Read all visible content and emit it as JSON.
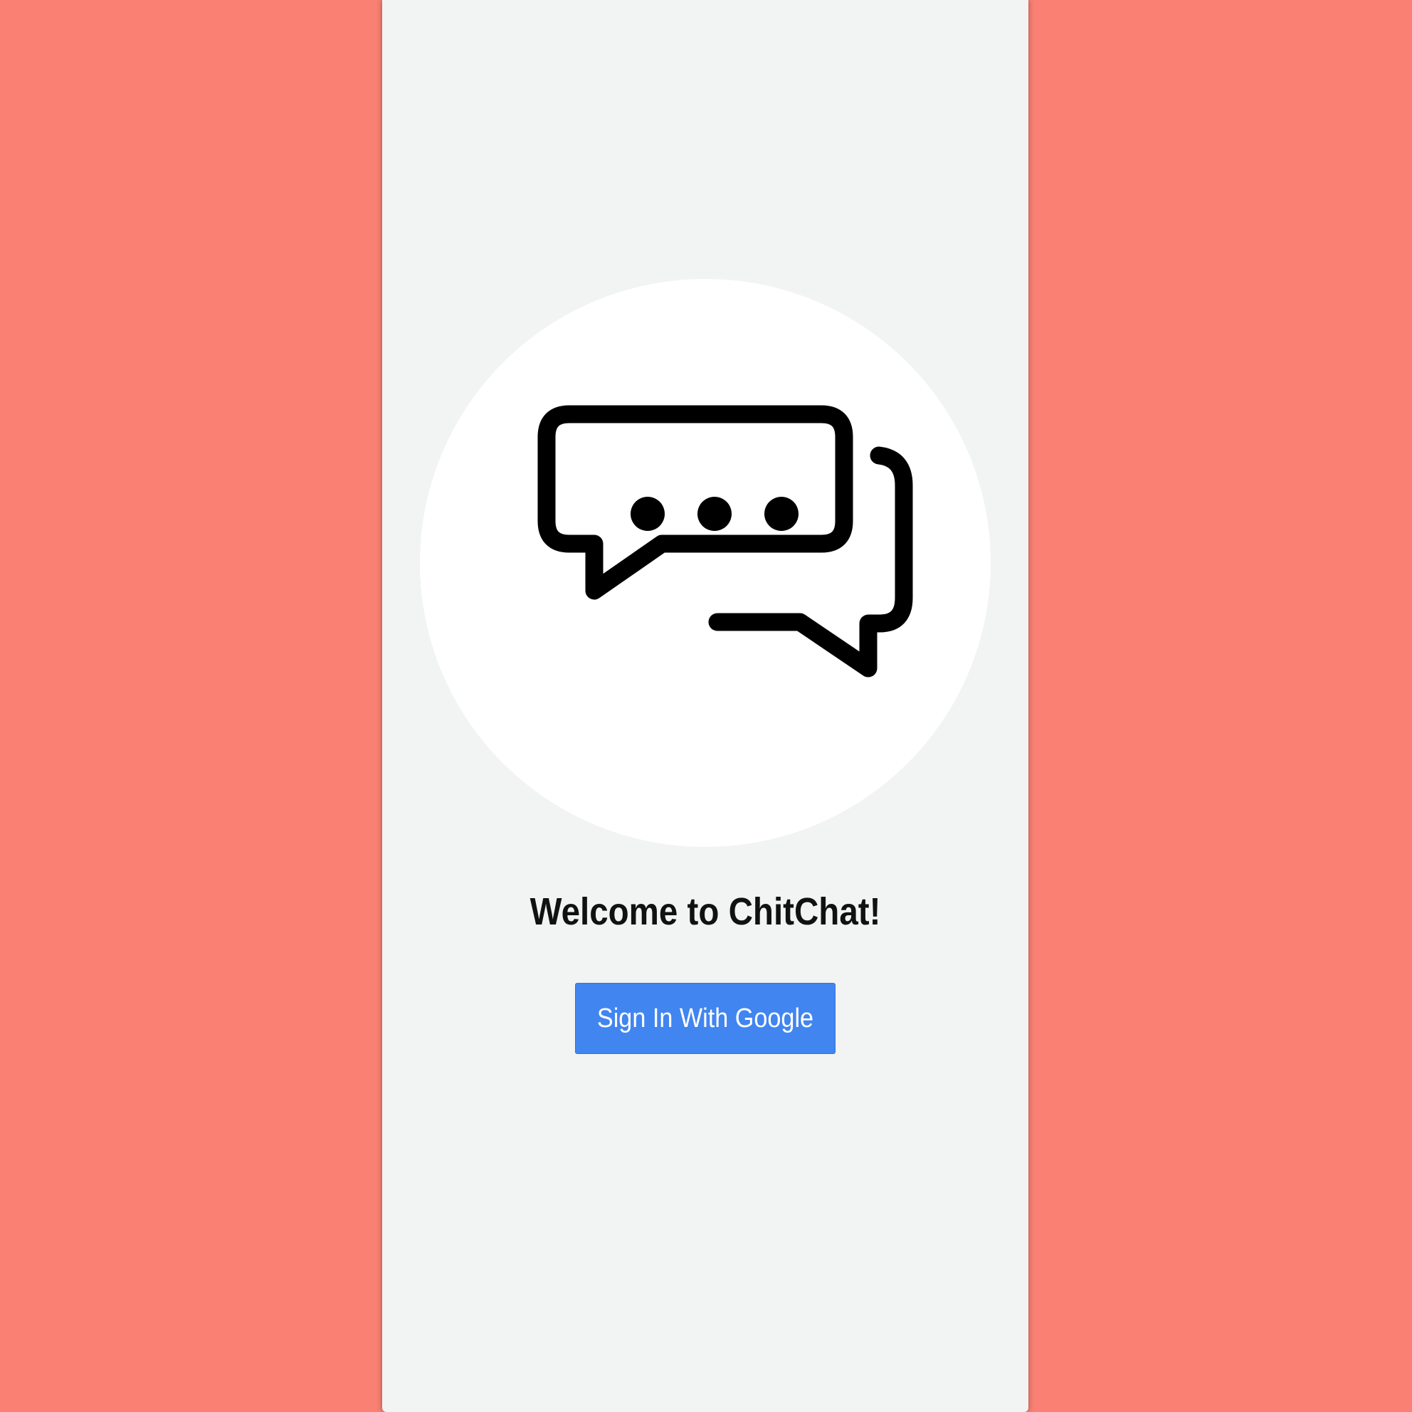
{
  "app": {
    "name": "ChitChat",
    "logo_icon": "chat-bubbles-icon"
  },
  "welcome": {
    "title": "Welcome to ChitChat!"
  },
  "auth": {
    "signin_label": "Sign In With Google"
  },
  "colors": {
    "background": "#f98073",
    "panel": "#f1f4f2",
    "button": "#4185f0",
    "button_text": "#ffffff",
    "title_text": "#111111"
  }
}
